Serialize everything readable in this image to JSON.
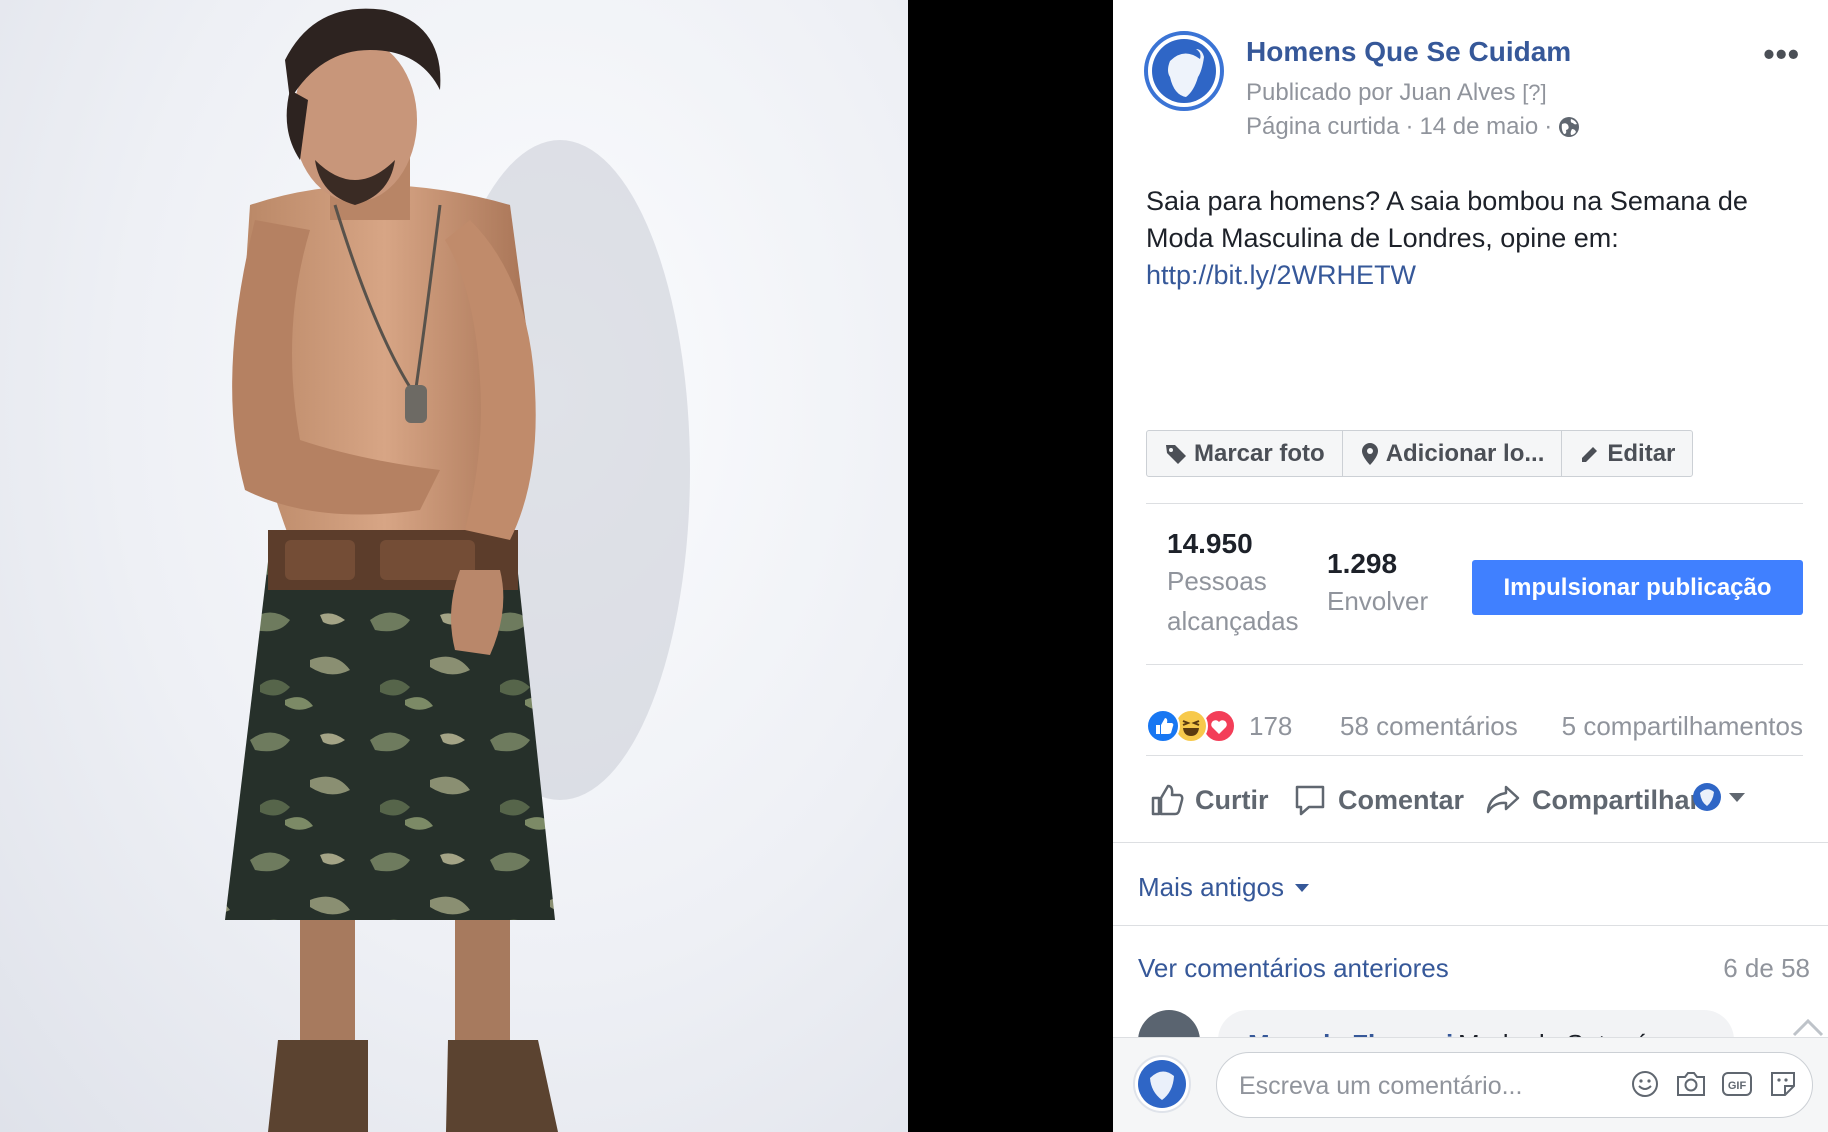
{
  "post": {
    "page_name": "Homens Que Se Cuidam",
    "published_by": "Publicado por Juan Alves",
    "help_marker": "[?]",
    "liked_label": "Página curtida",
    "dot_sep": "·",
    "date": "14 de maio",
    "more_label": "•••",
    "text": "Saia para homens? A saia bombou na Semana de Moda Masculina de Londres, opine em:",
    "link": "http://bit.ly/2WRHETW"
  },
  "photo_actions": {
    "tag_label": "Marcar foto",
    "location_label": "Adicionar lo...",
    "edit_label": "Editar"
  },
  "insights": {
    "reached_value": "14.950",
    "reached_line1": "Pessoas",
    "reached_line2": "alcançadas",
    "engage_value": "1.298",
    "engage_label": "Envolver",
    "boost_label": "Impulsionar publicação"
  },
  "engagement": {
    "reactions": [
      "like",
      "haha",
      "love"
    ],
    "reaction_count": "178",
    "comments": "58 comentários",
    "shares": "5 compartilhamentos"
  },
  "ufi": {
    "like_label": "Curtir",
    "comment_label": "Comentar",
    "share_label": "Compartilhar"
  },
  "comments": {
    "sort_label": "Mais antigos",
    "view_previous": "Ver comentários anteriores",
    "position": "6 de 58",
    "peek_name": "Marcela Florencio",
    "peek_text": "Moda do Satanás",
    "composer_placeholder": "Escreva um comentário..."
  },
  "colors": {
    "link_blue": "#365899",
    "boost_blue": "#4080ff",
    "meta_gray": "#90949c",
    "like_blue": "#1877f2",
    "love_red": "#f33e58",
    "haha_yellow": "#f7c94b"
  }
}
